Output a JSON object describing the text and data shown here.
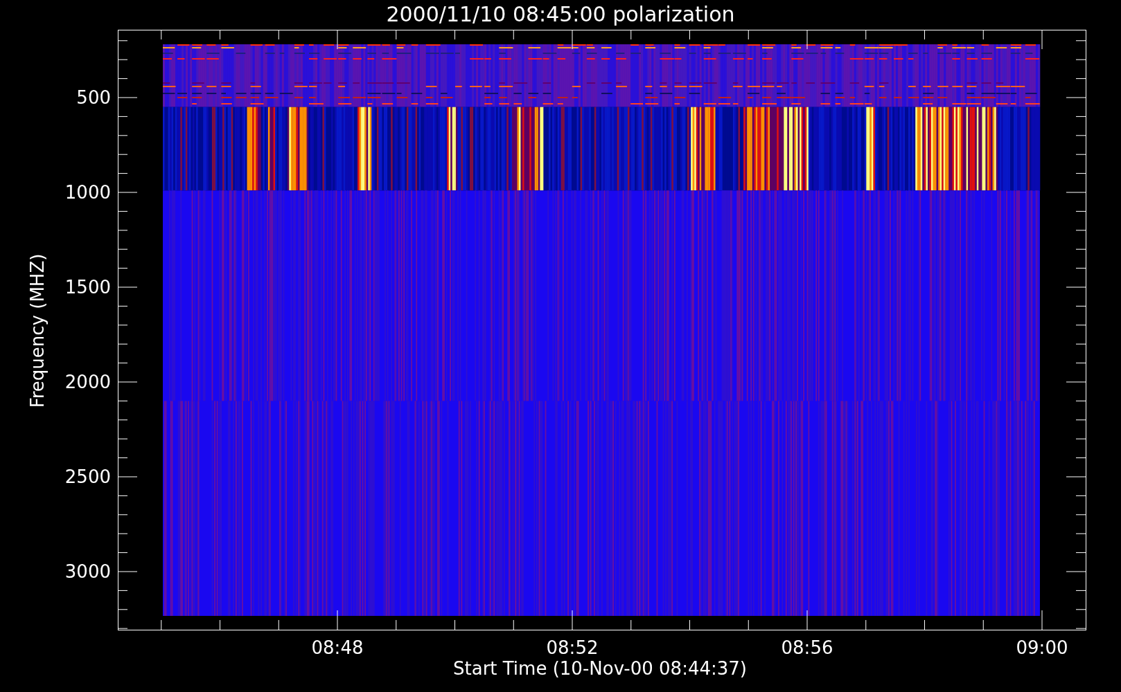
{
  "title": "2000/11/10 08:45:00 polarization",
  "y_axis": {
    "label": "Frequency (MHZ)",
    "ticks": [
      "500",
      "1000",
      "1500",
      "2000",
      "2500",
      "3000"
    ]
  },
  "x_axis": {
    "label": "Start Time (10-Nov-00 08:44:37)",
    "ticks": [
      "08:48",
      "08:52",
      "08:56",
      "09:00"
    ]
  }
}
